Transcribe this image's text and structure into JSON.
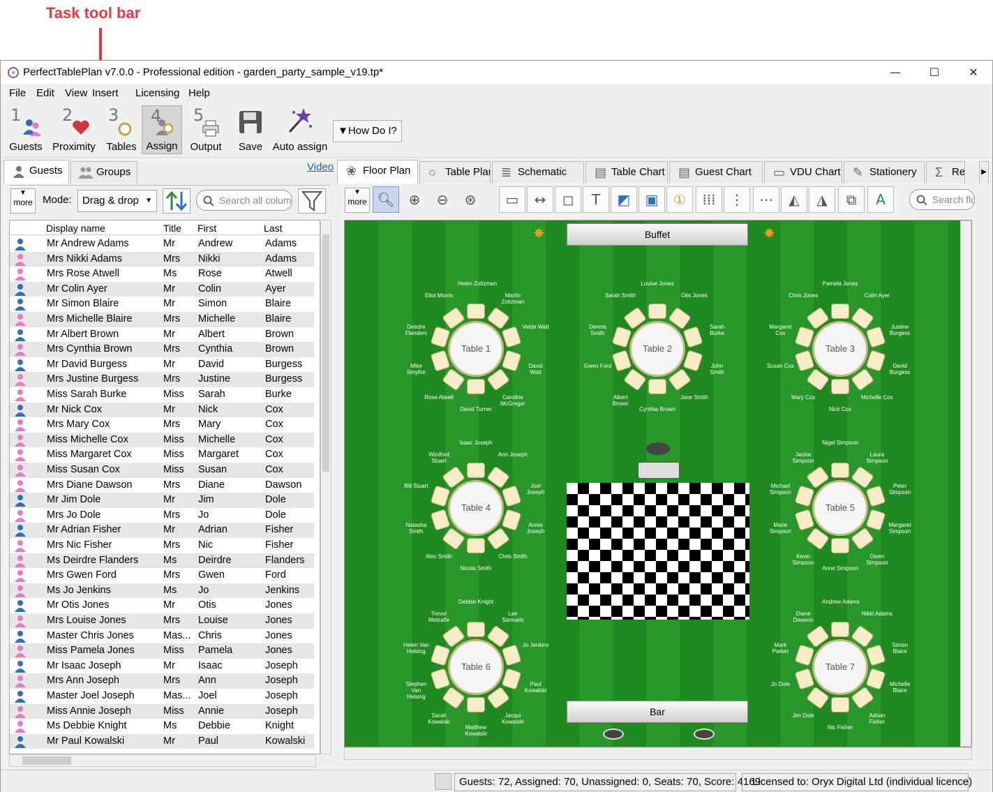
{
  "annotation": {
    "label": "Task tool bar"
  },
  "window": {
    "title": "PerfectTablePlan v7.0.0 - Professional edition - garden_party_sample_v19.tp*",
    "minimize": "—",
    "maximize": "☐",
    "close": "✕"
  },
  "menu": [
    "File",
    "Edit",
    "View",
    "Insert",
    "Licensing",
    "Help"
  ],
  "toolbar": {
    "guests": {
      "num": "1",
      "label": "Guests"
    },
    "proximity": {
      "num": "2",
      "label": "Proximity"
    },
    "tables": {
      "num": "3",
      "label": "Tables"
    },
    "assign": {
      "num": "4",
      "label": "Assign"
    },
    "output": {
      "num": "5",
      "label": "Output"
    },
    "save": {
      "label": "Save"
    },
    "auto_assign": {
      "label": "Auto assign"
    },
    "how_do_i": "▼How Do I?"
  },
  "left": {
    "tabs": [
      "Guests",
      "Groups"
    ],
    "video_link": "Video",
    "more": "more",
    "mode_label": "Mode:",
    "mode_value": "Drag & drop",
    "search_placeholder": "Search all columns",
    "columns": [
      "Display name",
      "Title",
      "First",
      "Last"
    ],
    "rows": [
      [
        "Mr Andrew Adams",
        "Mr",
        "Andrew",
        "Adams",
        "m"
      ],
      [
        "Mrs Nikki Adams",
        "Mrs",
        "Nikki",
        "Adams",
        "f"
      ],
      [
        "Mrs Rose Atwell",
        "Ms",
        "Rose",
        "Atwell",
        "f"
      ],
      [
        "Mr Colin Ayer",
        "Mr",
        "Colin",
        "Ayer",
        "m"
      ],
      [
        "Mr Simon Blaire",
        "Mr",
        "Simon",
        "Blaire",
        "m"
      ],
      [
        "Mrs Michelle Blaire",
        "Mrs",
        "Michelle",
        "Blaire",
        "f"
      ],
      [
        "Mr Albert Brown",
        "Mr",
        "Albert",
        "Brown",
        "m"
      ],
      [
        "Mrs Cynthia Brown",
        "Mrs",
        "Cynthia",
        "Brown",
        "f"
      ],
      [
        "Mr David Burgess",
        "Mr",
        "David",
        "Burgess",
        "m"
      ],
      [
        "Mrs Justine Burgess",
        "Mrs",
        "Justine",
        "Burgess",
        "f"
      ],
      [
        "Miss Sarah Burke",
        "Miss",
        "Sarah",
        "Burke",
        "f"
      ],
      [
        "Mr Nick Cox",
        "Mr",
        "Nick",
        "Cox",
        "m"
      ],
      [
        "Mrs Mary Cox",
        "Mrs",
        "Mary",
        "Cox",
        "f"
      ],
      [
        "Miss Michelle Cox",
        "Miss",
        "Michelle",
        "Cox",
        "f"
      ],
      [
        "Miss Margaret Cox",
        "Miss",
        "Margaret",
        "Cox",
        "f"
      ],
      [
        "Miss Susan Cox",
        "Miss",
        "Susan",
        "Cox",
        "f"
      ],
      [
        "Mrs Diane Dawson",
        "Mrs",
        "Diane",
        "Dawson",
        "f"
      ],
      [
        "Mr Jim Dole",
        "Mr",
        "Jim",
        "Dole",
        "m"
      ],
      [
        "Mrs Jo Dole",
        "Mrs",
        "Jo",
        "Dole",
        "f"
      ],
      [
        "Mr Adrian Fisher",
        "Mr",
        "Adrian",
        "Fisher",
        "m"
      ],
      [
        "Mrs Nic Fisher",
        "Mrs",
        "Nic",
        "Fisher",
        "f"
      ],
      [
        "Ms Deirdre Flanders",
        "Ms",
        "Deirdre",
        "Flanders",
        "f"
      ],
      [
        "Mrs Gwen Ford",
        "Mrs",
        "Gwen",
        "Ford",
        "f"
      ],
      [
        "Ms Jo Jenkins",
        "Ms",
        "Jo",
        "Jenkins",
        "f"
      ],
      [
        "Mr Otis Jones",
        "Mr",
        "Otis",
        "Jones",
        "m"
      ],
      [
        "Mrs Louise Jones",
        "Mrs",
        "Louise",
        "Jones",
        "f"
      ],
      [
        "Master Chris Jones",
        "Mas...",
        "Chris",
        "Jones",
        "m"
      ],
      [
        "Miss Pamela Jones",
        "Miss",
        "Pamela",
        "Jones",
        "f"
      ],
      [
        "Mr Isaac Joseph",
        "Mr",
        "Isaac",
        "Joseph",
        "m"
      ],
      [
        "Mrs Ann Joseph",
        "Mrs",
        "Ann",
        "Joseph",
        "f"
      ],
      [
        "Master Joel Joseph",
        "Mas...",
        "Joel",
        "Joseph",
        "m"
      ],
      [
        "Miss Annie Joseph",
        "Miss",
        "Annie",
        "Joseph",
        "f"
      ],
      [
        "Ms Debbie Knight",
        "Ms",
        "Debbie",
        "Knight",
        "f"
      ],
      [
        "Mr Paul Kowalski",
        "Mr",
        "Paul",
        "Kowalski",
        "m"
      ]
    ]
  },
  "right": {
    "tabs": [
      "Floor Plan",
      "Table Plan",
      "Schematic",
      "Table Chart",
      "Guest Chart",
      "VDU Chart",
      "Stationery",
      "Rep"
    ],
    "more": "more",
    "search_placeholder": "Search floor plan",
    "buffet": "Buffet",
    "bar": "Bar",
    "tables": [
      {
        "label": "Table 1",
        "guests": [
          "Helen Zoltzman",
          "Martin\nZoltzman",
          "Velda Watt",
          "David\nWatt",
          "Caroline\nMcGregor",
          "David Turner",
          "Rose Atwell",
          "Mike\nSmythe",
          "Deirdre\nFlanders",
          "Eliot Morris"
        ]
      },
      {
        "label": "Table 2",
        "guests": [
          "Louise Jones",
          "Otis Jones",
          "Sarah\nBurke",
          "John\nSmith",
          "Jane Smith",
          "Cynthia Brown",
          "Albert\nBrown",
          "Gwen Ford",
          "Dennis\nSmith",
          "Sarah Smith"
        ]
      },
      {
        "label": "Table 3",
        "guests": [
          "Pamela Jones",
          "Colin Ayer",
          "Justine\nBurgess",
          "David\nBurgess",
          "Michelle Cox",
          "Nick Cox",
          "Mary Cox",
          "Susan Cox",
          "Margaret\nCox",
          "Chris Jones"
        ]
      },
      {
        "label": "Table 4",
        "guests": [
          "Isaac Joseph",
          "Ann Joseph",
          "Joel\nJoseph",
          "Annie\nJoseph",
          "Chris Smith",
          "Nicola Smith",
          "Alex Smith",
          "Natasha\nSmith",
          "Bill Stuart",
          "Winifred\nStuart"
        ]
      },
      {
        "label": "Table 5",
        "guests": [
          "Nigel Simpson",
          "Laura\nSimpson",
          "Peter\nSimpson",
          "Margaret\nSimpson",
          "Owen\nSimpson",
          "Anne Simpson",
          "Kevin\nSimpson",
          "Marie\nSimpson",
          "Michael\nSimpson",
          "Jackie\nSimpson"
        ]
      },
      {
        "label": "Table 6",
        "guests": [
          "Debbie Knight",
          "Lee\nSamuels",
          "Jo Jenkins",
          "Paul\nKowalski",
          "Jacqui\nKowalski",
          "Matthew\nKowalski",
          "Sarah\nKowalski",
          "Stephen\nVan\nHelsing",
          "Helen Van\nHelsing",
          "Trevor\nMetcalfe"
        ]
      },
      {
        "label": "Table 7",
        "guests": [
          "Andrew Adams",
          "Nikki Adams",
          "Simon\nBlaire",
          "Michelle\nBlaire",
          "Adrian\nFisher",
          "Nic Fisher",
          "Jim Dole",
          "Jo Dole",
          "Mark\nParker",
          "Diane\nDawson"
        ]
      }
    ]
  },
  "status": {
    "summary": "Guests: 72, Assigned: 70, Unassigned: 0, Seats: 70, Score: 4169",
    "license": "Licensed to: Oryx Digital Ltd (individual licence)"
  },
  "colors": {
    "male": "#2f6fbf",
    "female": "#e47cc0",
    "grass_dark": "#1f8a1f",
    "grass_light": "#27972a",
    "annotation": "#e8383d"
  }
}
